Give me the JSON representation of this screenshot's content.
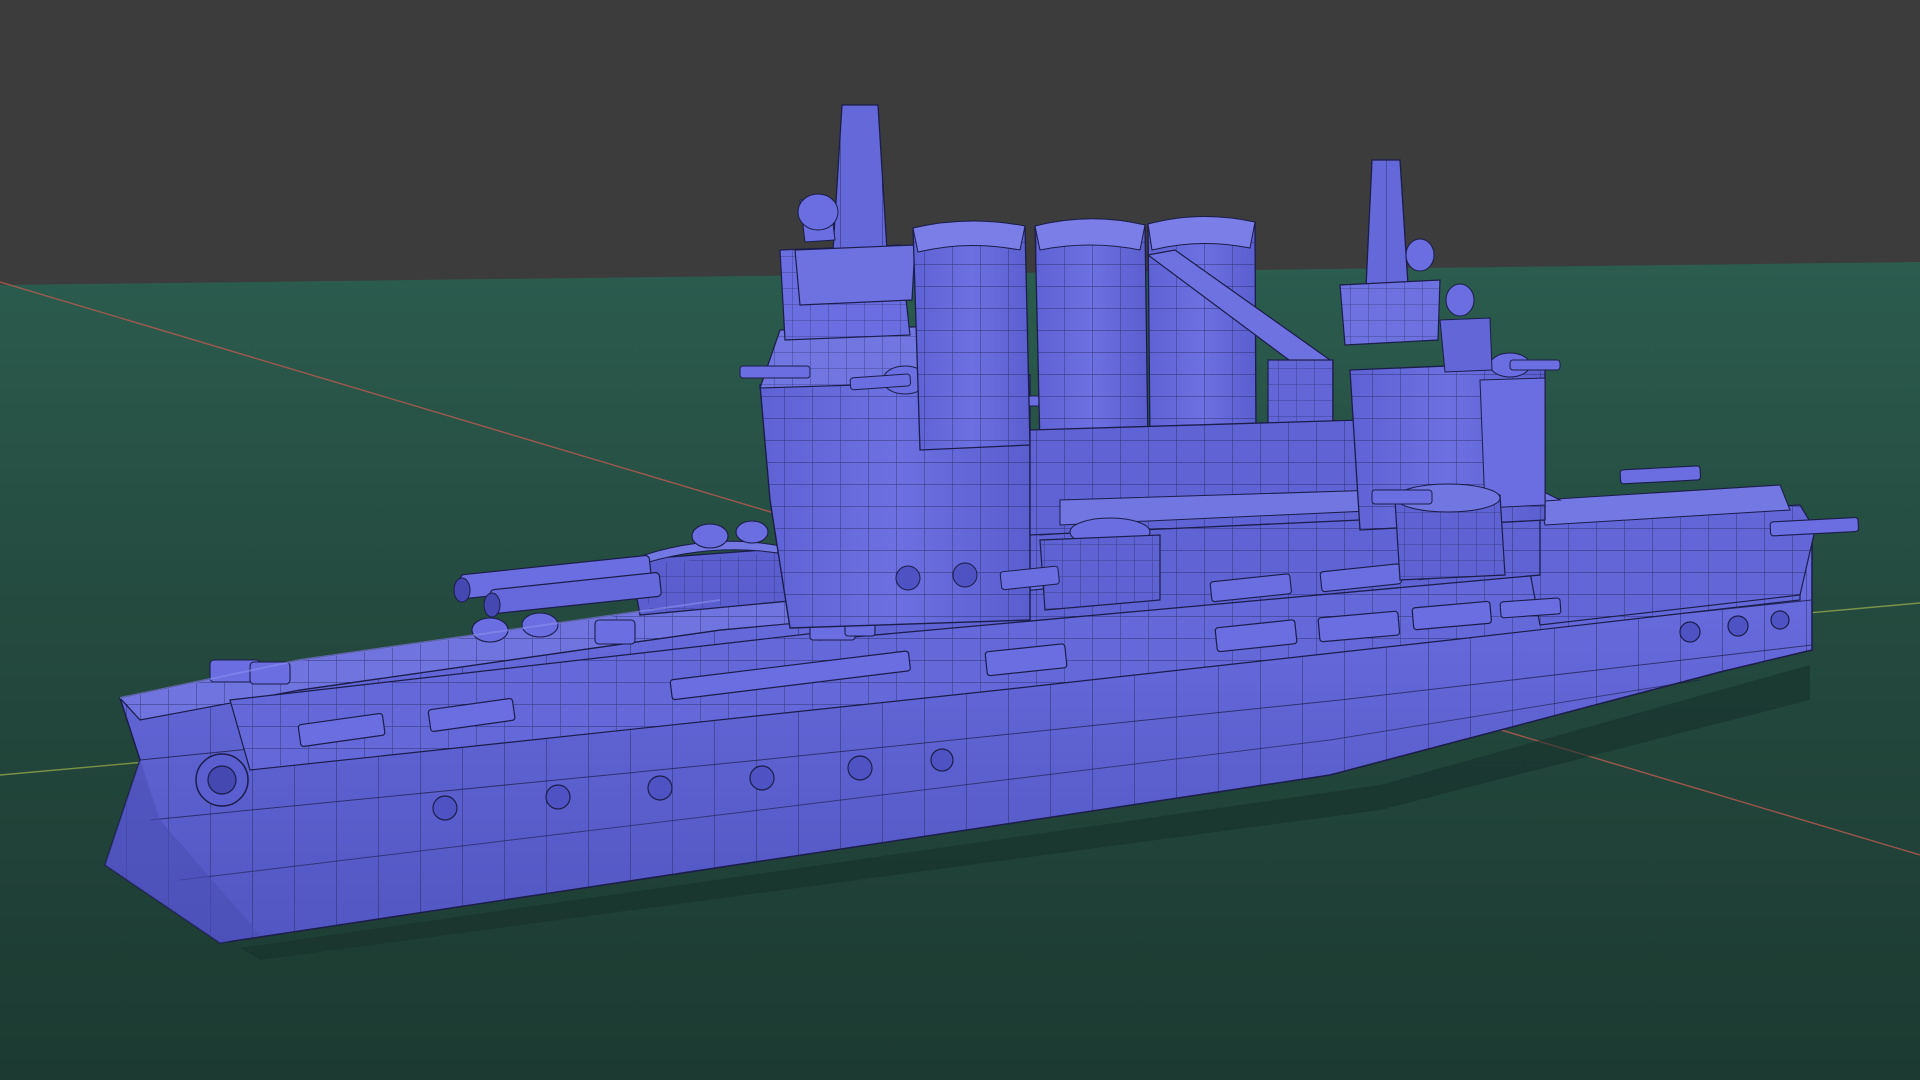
{
  "scene": {
    "subject": "battleship-model",
    "render_mode": "solid-with-wireframe-overlay",
    "colors": {
      "background": "#3c3c3c",
      "ground_near": "#1f3a31",
      "ground_far": "#2a5a4c",
      "hull": "#5f63d2",
      "hull_shadow": "#4a4eb4",
      "hull_light": "#7478e0",
      "wire": "#1b1d4a",
      "axis_x": "#b25a52",
      "axis_y": "#8aa04a"
    },
    "axes": {
      "x_visible": true,
      "y_visible": true
    }
  }
}
